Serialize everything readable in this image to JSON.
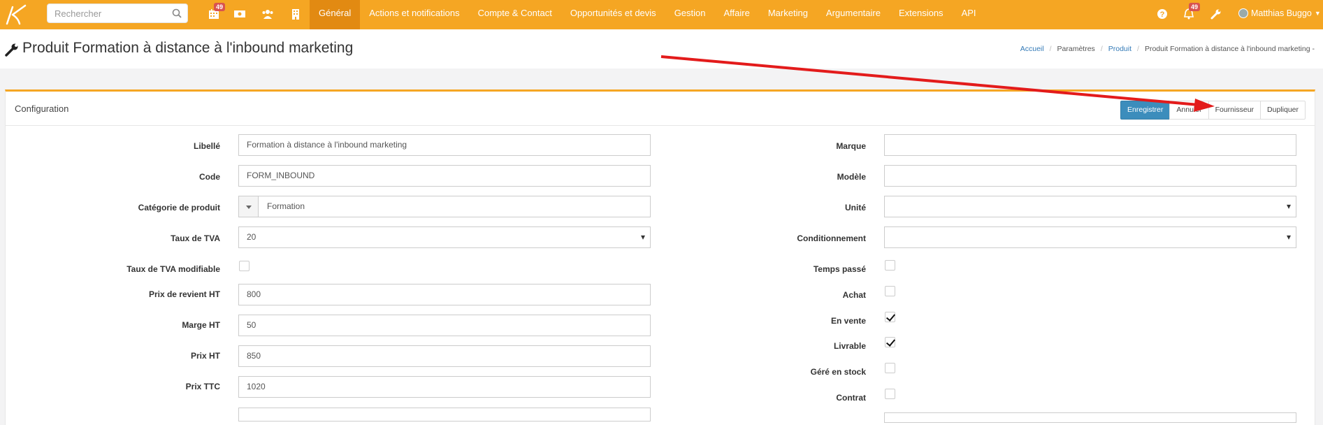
{
  "topbar": {
    "search_placeholder": "Rechercher",
    "calendar_badge": "49",
    "notifications_badge": "49",
    "user_name": "Matthias Buggo",
    "nav": [
      "Général",
      "Actions et notifications",
      "Compte & Contact",
      "Opportunités et devis",
      "Gestion",
      "Affaire",
      "Marketing",
      "Argumentaire",
      "Extensions",
      "API"
    ],
    "active_nav": "Général"
  },
  "page": {
    "title": "Produit Formation à distance à l'inbound marketing",
    "breadcrumb": {
      "home": "Accueil",
      "settings": "Paramètres",
      "product": "Produit",
      "current": "Produit Formation à distance à l'inbound marketing -"
    }
  },
  "panel": {
    "title": "Configuration",
    "buttons": {
      "save": "Enregistrer",
      "cancel": "Annuler",
      "supplier": "Fournisseur",
      "duplicate": "Dupliquer"
    }
  },
  "form_left": {
    "libelle": {
      "label": "Libellé",
      "value": "Formation à distance à l'inbound marketing"
    },
    "code": {
      "label": "Code",
      "value": "FORM_INBOUND"
    },
    "categorie": {
      "label": "Catégorie de produit",
      "value": "Formation"
    },
    "tva": {
      "label": "Taux de TVA",
      "value": "20"
    },
    "tva_modifiable": {
      "label": "Taux de TVA modifiable",
      "checked": false
    },
    "prix_revient": {
      "label": "Prix de revient HT",
      "value": "800"
    },
    "marge": {
      "label": "Marge HT",
      "value": "50"
    },
    "prix_ht": {
      "label": "Prix HT",
      "value": "850"
    },
    "prix_ttc": {
      "label": "Prix TTC",
      "value": "1020"
    }
  },
  "form_right": {
    "marque": {
      "label": "Marque",
      "value": ""
    },
    "modele": {
      "label": "Modèle",
      "value": ""
    },
    "unite": {
      "label": "Unité",
      "value": ""
    },
    "conditionnement": {
      "label": "Conditionnement",
      "value": ""
    },
    "temps_passe": {
      "label": "Temps passé",
      "checked": false
    },
    "achat": {
      "label": "Achat",
      "checked": false
    },
    "en_vente": {
      "label": "En vente",
      "checked": true
    },
    "livrable": {
      "label": "Livrable",
      "checked": true
    },
    "gere_stock": {
      "label": "Géré en stock",
      "checked": false
    },
    "contrat": {
      "label": "Contrat",
      "checked": false
    }
  },
  "colors": {
    "accent": "#f5a623",
    "accent_dark": "#e28a12",
    "primary_button": "#3c8dbc",
    "annotation_arrow": "#e31b1b",
    "badge": "#d9534f"
  }
}
